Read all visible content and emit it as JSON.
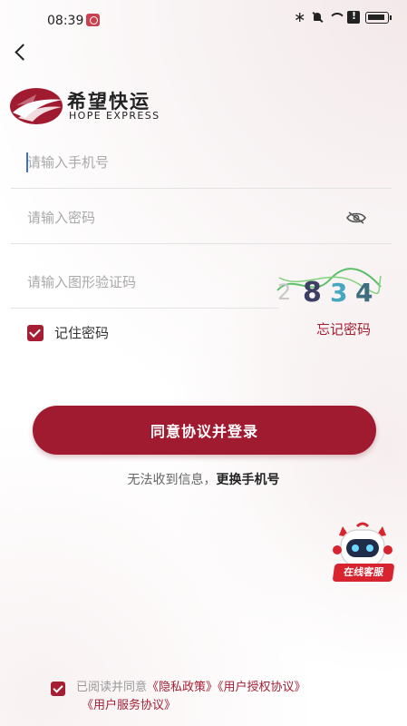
{
  "status_bar": {
    "time": "08:39"
  },
  "logo": {
    "name_cn": "希望快运",
    "name_en": "HOPE EXPRESS"
  },
  "form": {
    "phone_placeholder": "请输入手机号",
    "password_placeholder": "请输入密码",
    "captcha_placeholder": "请输入图形验证码",
    "captcha_code": "2834",
    "remember_label": "记住密码",
    "remember_checked": true,
    "forgot_label": "忘记密码",
    "login_label": "同意协议并登录",
    "no_sms_text": "无法收到信息，",
    "change_phone_label": "更换手机号"
  },
  "support": {
    "badge_label": "在线客服"
  },
  "agreement": {
    "checked": true,
    "prefix": "已阅读并同意",
    "privacy": "《隐私政策》",
    "authorization": "《用户授权协议》",
    "service": "《用户服务协议》"
  },
  "colors": {
    "brand": "#a11b30",
    "link": "#a51e34"
  }
}
